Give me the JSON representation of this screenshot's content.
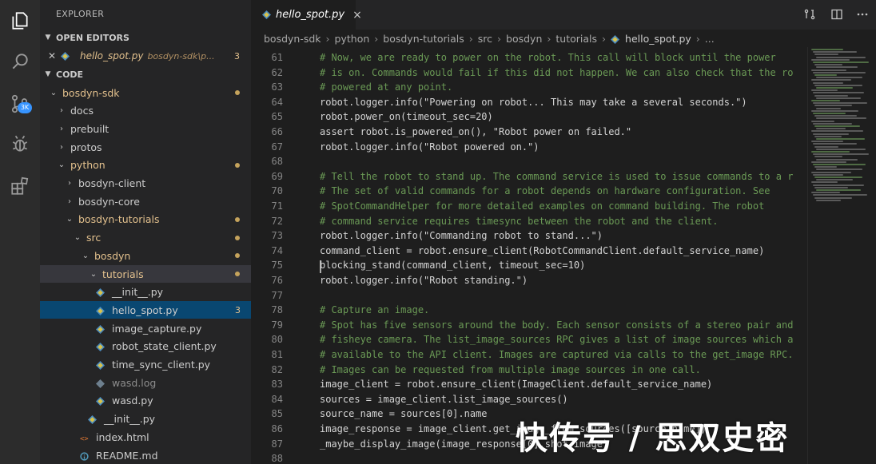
{
  "sidebar": {
    "title": "EXPLORER",
    "open_editors": {
      "label": "OPEN EDITORS",
      "file": "hello_spot.py",
      "path": "bosdyn-sdk\\p...",
      "count": "3"
    },
    "code_section": "CODE",
    "tree": [
      {
        "label": "bosdyn-sdk",
        "depth": 1,
        "type": "folder-open",
        "mod": true,
        "dot": true
      },
      {
        "label": "docs",
        "depth": 2,
        "type": "folder"
      },
      {
        "label": "prebuilt",
        "depth": 2,
        "type": "folder"
      },
      {
        "label": "protos",
        "depth": 2,
        "type": "folder"
      },
      {
        "label": "python",
        "depth": 2,
        "type": "folder-open",
        "mod": true,
        "dot": true
      },
      {
        "label": "bosdyn-client",
        "depth": 3,
        "type": "folder"
      },
      {
        "label": "bosdyn-core",
        "depth": 3,
        "type": "folder"
      },
      {
        "label": "bosdyn-tutorials",
        "depth": 3,
        "type": "folder-open",
        "mod": true,
        "dot": true
      },
      {
        "label": "src",
        "depth": 4,
        "type": "folder-open",
        "mod": true,
        "dot": true
      },
      {
        "label": "bosdyn",
        "depth": 5,
        "type": "folder-open",
        "mod": true,
        "dot": true
      },
      {
        "label": "tutorials",
        "depth": 6,
        "type": "folder-open",
        "mod": true,
        "dot": true,
        "hl": true
      },
      {
        "label": "__init__.py",
        "depth": 7,
        "type": "py"
      },
      {
        "label": "hello_spot.py",
        "depth": 7,
        "type": "py",
        "sel": true,
        "count": "3"
      },
      {
        "label": "image_capture.py",
        "depth": 7,
        "type": "py"
      },
      {
        "label": "robot_state_client.py",
        "depth": 7,
        "type": "py"
      },
      {
        "label": "time_sync_client.py",
        "depth": 7,
        "type": "py"
      },
      {
        "label": "wasd.log",
        "depth": 7,
        "type": "log",
        "dim": true
      },
      {
        "label": "wasd.py",
        "depth": 7,
        "type": "py"
      },
      {
        "label": "__init__.py",
        "depth": 6,
        "type": "py"
      },
      {
        "label": "index.html",
        "depth": 5,
        "type": "html"
      },
      {
        "label": "README.md",
        "depth": 5,
        "type": "md"
      }
    ]
  },
  "tab": {
    "label": "hello_spot.py",
    "close": "×"
  },
  "breadcrumb": [
    "bosdyn-sdk",
    "python",
    "bosdyn-tutorials",
    "src",
    "bosdyn",
    "tutorials",
    "hello_spot.py",
    "..."
  ],
  "code": [
    {
      "n": "61",
      "text": "# Now, we are ready to power on the robot. This call will block until the power",
      "comment": true
    },
    {
      "n": "62",
      "text": "# is on. Commands would fail if this did not happen. We can also check that the ro",
      "comment": true
    },
    {
      "n": "63",
      "text": "# powered at any point.",
      "comment": true
    },
    {
      "n": "64",
      "text": "robot.logger.info(\"Powering on robot... This may take a several seconds.\")"
    },
    {
      "n": "65",
      "text": "robot.power_on(timeout_sec=20)"
    },
    {
      "n": "66",
      "text": "assert robot.is_powered_on(), \"Robot power on failed.\""
    },
    {
      "n": "67",
      "text": "robot.logger.info(\"Robot powered on.\")"
    },
    {
      "n": "68",
      "text": ""
    },
    {
      "n": "69",
      "text": "# Tell the robot to stand up. The command service is used to issue commands to a r",
      "comment": true
    },
    {
      "n": "70",
      "text": "# The set of valid commands for a robot depends on hardware configuration. See",
      "comment": true
    },
    {
      "n": "71",
      "text": "# SpotCommandHelper for more detailed examples on command building. The robot",
      "comment": true
    },
    {
      "n": "72",
      "text": "# command service requires timesync between the robot and the client.",
      "comment": true
    },
    {
      "n": "73",
      "text": "robot.logger.info(\"Commanding robot to stand...\")"
    },
    {
      "n": "74",
      "text": "command_client = robot.ensure_client(RobotCommandClient.default_service_name)"
    },
    {
      "n": "75",
      "text": "blocking_stand(command_client, timeout_sec=10)"
    },
    {
      "n": "76",
      "text": "robot.logger.info(\"Robot standing.\")"
    },
    {
      "n": "77",
      "text": ""
    },
    {
      "n": "78",
      "text": "# Capture an image.",
      "comment": true
    },
    {
      "n": "79",
      "text": "# Spot has five sensors around the body. Each sensor consists of a stereo pair and",
      "comment": true
    },
    {
      "n": "80",
      "text": "# fisheye camera. The list_image_sources RPC gives a list of image sources which a",
      "comment": true
    },
    {
      "n": "81",
      "text": "# available to the API client. Images are captured via calls to the get_image RPC.",
      "comment": true
    },
    {
      "n": "82",
      "text": "# Images can be requested from multiple image sources in one call.",
      "comment": true
    },
    {
      "n": "83",
      "text": "image_client = robot.ensure_client(ImageClient.default_service_name)"
    },
    {
      "n": "84",
      "text": "sources = image_client.list_image_sources()"
    },
    {
      "n": "85",
      "text": "source_name = sources[0].name"
    },
    {
      "n": "86",
      "text": "image_response = image_client.get_image_from_sources([source_name])"
    },
    {
      "n": "87",
      "text": "_maybe_display_image(image_response[0].shot.image)"
    },
    {
      "n": "88",
      "text": ""
    }
  ],
  "watermark": "快传号 / 思双史密",
  "colors": {
    "activity_bar": "#2c2c2c",
    "sidebar": "#252526",
    "editor": "#1e1e1e",
    "selection": "#094771",
    "modified": "#e2c08d",
    "comment": "#6a9955",
    "badge": "#3794ff"
  },
  "icons": [
    "explorer-icon",
    "search-icon",
    "source-control-icon",
    "debug-icon",
    "extensions-icon",
    "split-editor-icon",
    "open-changes-icon",
    "more-actions-icon",
    "python-file-icon"
  ]
}
